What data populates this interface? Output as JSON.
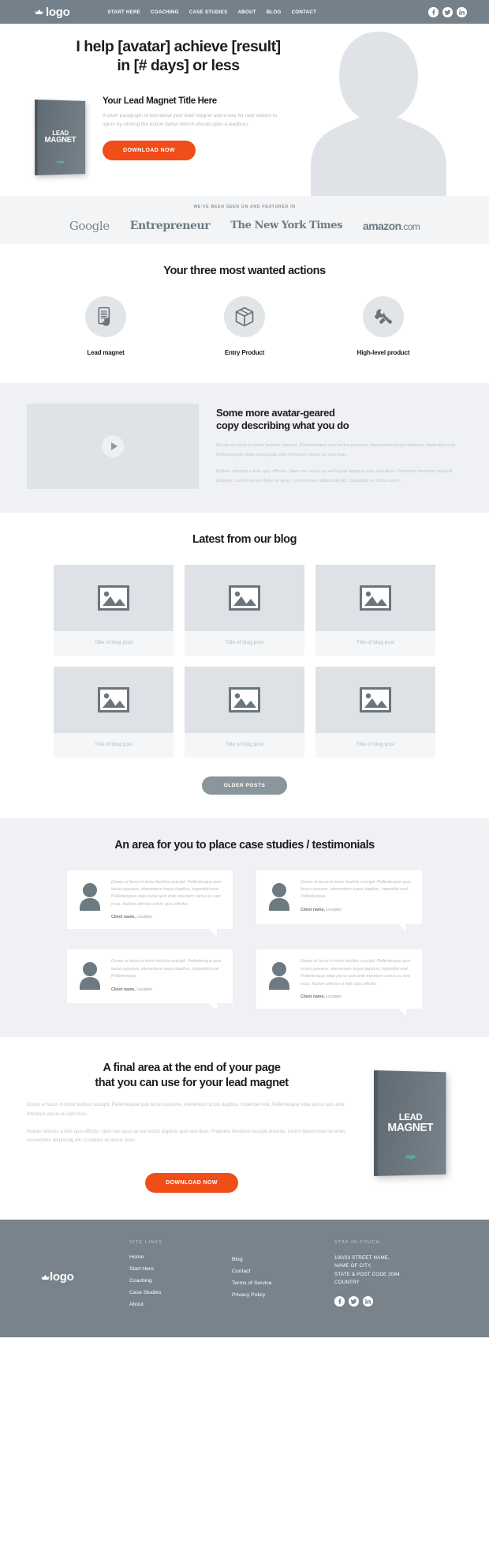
{
  "nav": {
    "logo_text": "logo",
    "logo_icon": "crown-icon",
    "links": [
      "START HERE",
      "COACHING",
      "CASE STUDIES",
      "ABOUT",
      "BLOG",
      "CONTACT"
    ],
    "social": [
      "facebook-icon",
      "twitter-icon",
      "linkedin-icon"
    ]
  },
  "hero": {
    "title_line1": "I help [avatar] achieve [result]",
    "title_line2": "in [# days] or less",
    "book_title_line1": "LEAD",
    "book_title_line2": "MAGNET",
    "book_logo": "logo",
    "lead_magnet_title": "Your Lead Magnet Title Here",
    "lead_magnet_paragraph": "A short paragraph of text about your lead magnet and a way for new visitors to opt-in by clicking the button below (which should open a leadbox).",
    "cta_label": "DOWNLOAD NOW",
    "avatar_icon": "person-silhouette-icon"
  },
  "featured": {
    "label": "WE'VE BEEN SEEN ON AND FEATURED IN",
    "logos": [
      "Google",
      "Entrepreneur",
      "The New York Times",
      "amazon",
      "com"
    ]
  },
  "actions": {
    "title": "Your three most wanted actions",
    "items": [
      {
        "label": "Lead magnet",
        "icon": "tablet-hand-icon"
      },
      {
        "label": "Entry Product",
        "icon": "box-package-icon"
      },
      {
        "label": "High-level product",
        "icon": "wrench-tools-icon"
      }
    ]
  },
  "video_section": {
    "play_icon": "play-icon",
    "title_line1": "Some more avatar-geared",
    "title_line2": "copy describing what you do",
    "paragraph1": "Donec et lacus in tortor facilisis suscipit. Pellentesque quis lectus posuere, elementum turpis dapibus, imperdiet erat. Pellentesque vitae purus quis ante interdum varius eu sed risus.",
    "paragraph2": "Nullam ultricies a felis quis efficitur. Nam nec lacus ac est luctus dapibus quis sed diam. Praesent hendrerit suscipit pulvinar. Lorem ipsum dolor sit amet, consectetur adipiscing elit. Curabitur ac luctus dolor."
  },
  "blog": {
    "title": "Latest from our blog",
    "posts": [
      {
        "title": "Title of blog post",
        "icon": "image-placeholder-icon"
      },
      {
        "title": "Title of blog post",
        "icon": "image-placeholder-icon"
      },
      {
        "title": "Title of blog post",
        "icon": "image-placeholder-icon"
      },
      {
        "title": "Title of blog post",
        "icon": "image-placeholder-icon"
      },
      {
        "title": "Title of blog post",
        "icon": "image-placeholder-icon"
      },
      {
        "title": "Title of blog post",
        "icon": "image-placeholder-icon"
      }
    ],
    "older_label": "OLDER POSTS"
  },
  "testimonials": {
    "title": "An area for you to place case studies / testimonials",
    "items": [
      {
        "quote": "Donec et lacus in tortor facilisis suscipit. Pellentesque quis lectus posuere, elementum turpis dapibus, imperdiet erat. Pellentesque vitae purus quis ante interdum varius eu sed risus. Nullam ultricies a felis quis efficitur.",
        "author_name": "Client name,",
        "author_location": "Location",
        "avatar_icon": "person-silhouette-icon"
      },
      {
        "quote": "Donec et lacus in tortor facilisis suscipit. Pellentesque quis lectus posuere, elementum turpis dapibus, imperdiet erat. Pellentesque.",
        "author_name": "Client name,",
        "author_location": "Location",
        "avatar_icon": "person-silhouette-icon"
      },
      {
        "quote": "Donec et lacus in tortor facilisis suscipit. Pellentesque quis lectus posuere, elementum turpis dapibus, imperdiet erat. Pellentesque.",
        "author_name": "Client name,",
        "author_location": "Location",
        "avatar_icon": "person-silhouette-icon"
      },
      {
        "quote": "Donec et lacus in tortor facilisis suscipit. Pellentesque quis lectus posuere, elementum turpis dapibus, imperdiet erat. Pellentesque vitae purus quis ante interdum varius eu sed risus. Nullam ultricies a felis quis efficitur.",
        "author_name": "Client name,",
        "author_location": "Location",
        "avatar_icon": "person-silhouette-icon"
      }
    ]
  },
  "final_cta": {
    "title_line1": "A final area at the end of your page",
    "title_line2": "that you can use for your lead magnet",
    "paragraph1": "Donec et lacus in tortor facilisis suscipit. Pellentesque quis lectus posuere, elementum turpis dapibus, imperdiet erat. Pellentesque vitae purus quis ante interdum varius eu sed risus.",
    "paragraph2": "Nullam ultricies a felis quis efficitur. Nam nec lacus ac est luctus dapibus quis sed diam. Praesent hendrerit suscipit pulvinar. Lorem ipsum dolor sit amet, consectetur adipiscing elit. Curabitur ac luctus dolor.",
    "cta_label": "DOWNLOAD NOW",
    "book_title_line1": "LEAD",
    "book_title_line2": "MAGNET",
    "book_logo": "logo"
  },
  "footer": {
    "logo_text": "logo",
    "logo_icon": "crown-icon",
    "site_links_heading": "SITE LINKS",
    "links_col1": [
      "Home",
      "Start Here",
      "Coaching",
      "Case Studies",
      "About"
    ],
    "links_col2": [
      "Blog",
      "Contact",
      "Terms of Service",
      "Privacy Policy"
    ],
    "stay_in_touch_heading": "STAY IN TOUCH",
    "address": "100/23 STREET NAME,\nNAME OF CITY,\nSTATE & POST CODE 2084\nCOUNTRY",
    "social": [
      "facebook-icon",
      "twitter-icon",
      "linkedin-icon"
    ]
  },
  "colors": {
    "nav_bg": "#74808a",
    "cta_orange": "#f04d18",
    "band_bg": "#eff1f4",
    "footer_bg": "#78838c",
    "muted_text": "#c0c6cb",
    "book_teal": "#4fd0c4"
  }
}
